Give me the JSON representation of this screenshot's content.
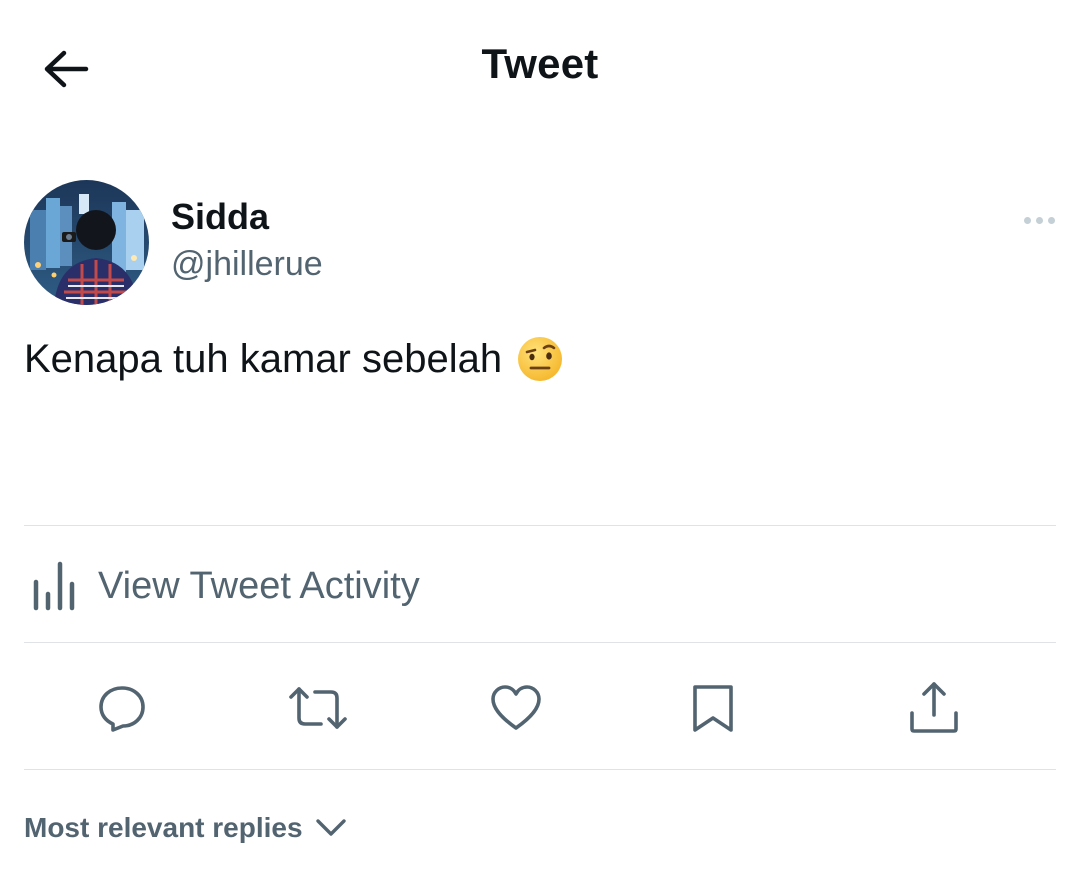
{
  "header": {
    "title": "Tweet",
    "back_icon": "arrow-left-icon"
  },
  "tweet": {
    "author": {
      "name": "Sidda",
      "handle": "@jhillerue",
      "avatar_icon": "avatar-photo"
    },
    "text": "Kenapa tuh kamar sebelah",
    "emoji_icon": "face-with-raised-eyebrow-emoji",
    "more_icon": "more-horizontal-icon"
  },
  "activity": {
    "label": "View Tweet Activity",
    "icon": "bar-chart-icon"
  },
  "actions": [
    {
      "name": "reply",
      "icon": "reply-bubble-icon"
    },
    {
      "name": "retweet",
      "icon": "retweet-icon"
    },
    {
      "name": "like",
      "icon": "heart-icon"
    },
    {
      "name": "bookmark",
      "icon": "bookmark-icon"
    },
    {
      "name": "share",
      "icon": "share-upload-icon"
    }
  ],
  "replies": {
    "sort_label": "Most relevant replies",
    "sort_icon": "chevron-down-icon"
  },
  "colors": {
    "text_primary": "#0f1419",
    "text_secondary": "#536471",
    "divider": "#dfe3e6",
    "background": "#ffffff"
  }
}
